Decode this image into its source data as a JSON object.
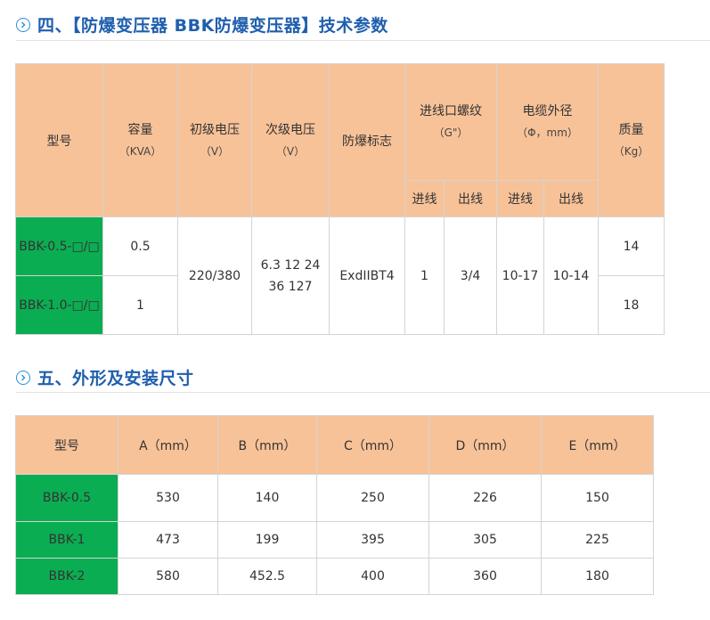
{
  "section4": {
    "title": "四、【防爆变压器 BBK防爆变压器】技术参数",
    "headers": {
      "model": "型号",
      "capacity": "容量",
      "capacity_unit": "（KVA）",
      "primary_voltage": "初级电压",
      "primary_unit": "（V）",
      "secondary_voltage": "次级电压",
      "secondary_unit": "（V）",
      "explosion_mark": "防爆标志",
      "thread": "进线口螺纹",
      "thread_unit": "（G\"）",
      "cable": "电缆外径",
      "cable_unit": "（Φ，mm）",
      "weight": "质量",
      "weight_unit": "（Kg）",
      "in1": "进线",
      "out1": "出线",
      "in2": "进线",
      "out2": "出线"
    },
    "rows": [
      {
        "model": "BBK-0.5-□/□",
        "capacity": "0.5",
        "weight": "14"
      },
      {
        "model": "BBK-1.0-□/□",
        "capacity": "1",
        "weight": "18"
      }
    ],
    "shared": {
      "primary": "220/380",
      "secondary_line1": "6.3 12 24",
      "secondary_line2": "36 127",
      "mark": "ExdIIBT4",
      "thread_in": "1",
      "thread_out": "3/4",
      "cable_in": "10-17",
      "cable_out": "10-14"
    }
  },
  "section5": {
    "title": "五、外形及安装尺寸",
    "headers": [
      "型号",
      "A（mm）",
      "B（mm）",
      "C（mm）",
      "D（mm）",
      "E（mm）"
    ],
    "rows": [
      [
        "BBK-0.5",
        "530",
        "140",
        "250",
        "226",
        "150"
      ],
      [
        "BBK-1",
        "473",
        "199",
        "395",
        "305",
        "225"
      ],
      [
        "BBK-2",
        "580",
        "452.5",
        "400",
        "360",
        "180"
      ]
    ]
  },
  "colors": {
    "header_bg": "#f8c298",
    "model_bg": "#0bad52",
    "title_color": "#1f5fae",
    "icon_color": "#2a8fd6"
  }
}
